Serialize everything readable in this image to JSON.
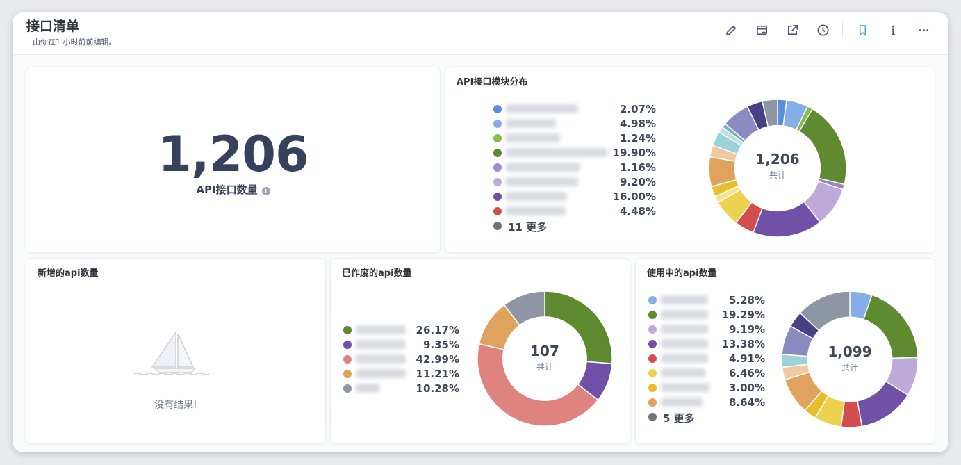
{
  "header": {
    "title": "接口清单",
    "subtitle": "由你在1 小时前前编辑。",
    "toolbar": [
      {
        "name": "edit-icon"
      },
      {
        "name": "add-to-dashboard-icon"
      },
      {
        "name": "share-icon"
      },
      {
        "name": "clock-icon"
      },
      {
        "name": "bookmark-icon"
      },
      {
        "name": "info-icon"
      },
      {
        "name": "more-icon"
      }
    ]
  },
  "scalar": {
    "value": "1,206",
    "label": "API接口数量"
  },
  "module_chart": {
    "title": "API接口模块分布",
    "more": "11 更多",
    "total": "1,206",
    "total_label": "共计"
  },
  "new_chart": {
    "title": "新增的api数量",
    "empty_text": "没有结果!"
  },
  "deprecated_chart": {
    "title": "已作废的api数量",
    "total": "107",
    "total_label": "共计"
  },
  "inuse_chart": {
    "title": "使用中的api数量",
    "more": "5 更多",
    "total": "1,099",
    "total_label": "共计"
  },
  "chart_data": [
    {
      "type": "pie",
      "title": "API接口模块分布",
      "legend_values": [
        "2.07%",
        "4.98%",
        "1.24%",
        "19.90%",
        "1.16%",
        "9.20%",
        "16.00%",
        "4.48%"
      ],
      "colors": [
        "#5b8ee0",
        "#86aee8",
        "#86bc4c",
        "#5f8a2f",
        "#a18bcc",
        "#bdaad9",
        "#7151a8",
        "#d34d4c"
      ],
      "slices": [
        {
          "value": 2.07,
          "color": "#5b8ee0"
        },
        {
          "value": 4.98,
          "color": "#86aee8"
        },
        {
          "value": 1.24,
          "color": "#86bc4c"
        },
        {
          "value": 19.9,
          "color": "#5f8a2f"
        },
        {
          "value": 1.16,
          "color": "#9b84c5"
        },
        {
          "value": 9.2,
          "color": "#bdaad9"
        },
        {
          "value": 16.0,
          "color": "#7151a8"
        },
        {
          "value": 4.48,
          "color": "#d34d4c"
        },
        {
          "value": 6.2,
          "color": "#ecd24f"
        },
        {
          "value": 1.5,
          "color": "#f2e38c"
        },
        {
          "value": 2.4,
          "color": "#e9be2c"
        },
        {
          "value": 6.8,
          "color": "#e0a35e"
        },
        {
          "value": 2.7,
          "color": "#f0c9a4"
        },
        {
          "value": 3.4,
          "color": "#9bd3d8"
        },
        {
          "value": 1.3,
          "color": "#b9dfe3"
        },
        {
          "value": 1.0,
          "color": "#72b7bc"
        },
        {
          "value": 6.4,
          "color": "#8c8bc1"
        },
        {
          "value": 3.6,
          "color": "#483f84"
        },
        {
          "value": 3.5,
          "color": "#8e95a4"
        }
      ],
      "total": 1206
    },
    {
      "type": "pie",
      "title": "已作废的api数量",
      "legend_values": [
        "26.17%",
        "9.35%",
        "42.99%",
        "11.21%",
        "10.28%"
      ],
      "colors": [
        "#5f8a2f",
        "#7151a8",
        "#de837e",
        "#e0a35e",
        "#8e95a4"
      ],
      "slices": [
        {
          "value": 26.17,
          "color": "#5f8a2f"
        },
        {
          "value": 9.35,
          "color": "#7151a8"
        },
        {
          "value": 42.99,
          "color": "#de837e"
        },
        {
          "value": 11.21,
          "color": "#e0a35e"
        },
        {
          "value": 10.28,
          "color": "#8e95a4"
        }
      ],
      "total": 107
    },
    {
      "type": "pie",
      "title": "使用中的api数量",
      "legend_values": [
        "5.28%",
        "19.29%",
        "9.19%",
        "13.38%",
        "4.91%",
        "6.46%",
        "3.00%",
        "8.64%"
      ],
      "colors": [
        "#86aee8",
        "#5f8a2f",
        "#bdaad9",
        "#7151a8",
        "#d34d4c",
        "#ecd24f",
        "#e9be2c",
        "#e0a35e"
      ],
      "slices": [
        {
          "value": 5.28,
          "color": "#86aee8"
        },
        {
          "value": 19.29,
          "color": "#5f8a2f"
        },
        {
          "value": 9.19,
          "color": "#bdaad9"
        },
        {
          "value": 13.38,
          "color": "#7151a8"
        },
        {
          "value": 4.91,
          "color": "#d34d4c"
        },
        {
          "value": 6.46,
          "color": "#ecd24f"
        },
        {
          "value": 3.0,
          "color": "#e9be2c"
        },
        {
          "value": 8.64,
          "color": "#e0a35e"
        },
        {
          "value": 3.0,
          "color": "#f0c9a4"
        },
        {
          "value": 3.0,
          "color": "#9bd3d8"
        },
        {
          "value": 7.0,
          "color": "#8c8bc1"
        },
        {
          "value": 3.8,
          "color": "#483f84"
        },
        {
          "value": 13.05,
          "color": "#8e95a4"
        }
      ],
      "total": 1099
    }
  ]
}
